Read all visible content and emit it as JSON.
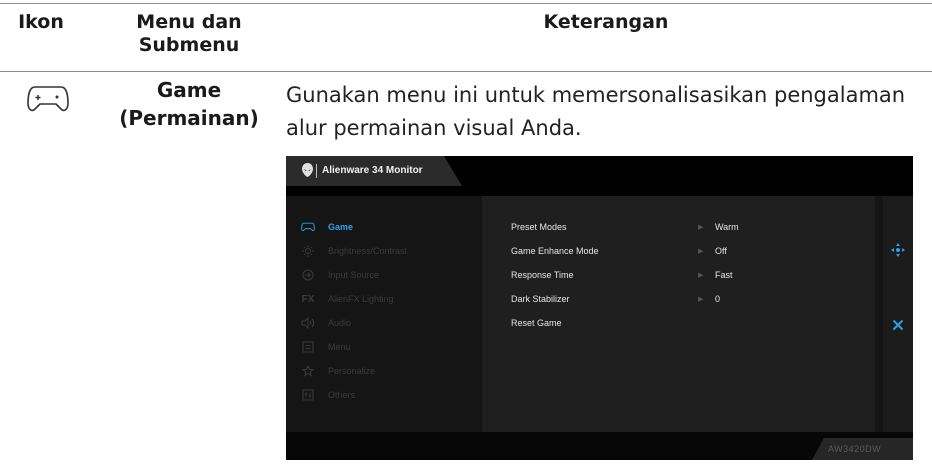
{
  "table": {
    "headers": {
      "icon": "Ikon",
      "menu": "Menu dan Submenu",
      "description": "Keterangan"
    },
    "row": {
      "menu_label": "Game (Permainan)",
      "description": "Gunakan menu ini untuk memersonalisasikan pengalaman alur permainan visual Anda."
    }
  },
  "osd": {
    "title": "Alienware 34 Monitor",
    "menu_items": [
      {
        "label": "Game",
        "icon": "gamepad-icon",
        "active": true
      },
      {
        "label": "Brightness/Contrast",
        "icon": "brightness-icon",
        "active": false
      },
      {
        "label": "Input Source",
        "icon": "input-source-icon",
        "active": false
      },
      {
        "label": "AlienFX Lighting",
        "icon": "fx-icon",
        "active": false
      },
      {
        "label": "Audio",
        "icon": "speaker-icon",
        "active": false
      },
      {
        "label": "Menu",
        "icon": "menu-icon",
        "active": false
      },
      {
        "label": "Personalize",
        "icon": "star-icon",
        "active": false
      },
      {
        "label": "Others",
        "icon": "others-icon",
        "active": false
      }
    ],
    "submenu": [
      {
        "label": "Preset Modes",
        "value": "Warm"
      },
      {
        "label": "Game Enhance Mode",
        "value": "Off"
      },
      {
        "label": "Response Time",
        "value": "Fast"
      },
      {
        "label": "Dark Stabilizer",
        "value": "0"
      },
      {
        "label": "Reset Game",
        "value": ""
      }
    ],
    "nav_icons": [
      "move-icon",
      "close-icon"
    ],
    "model": "AW3420DW",
    "accent_color": "#2aa3e6"
  }
}
